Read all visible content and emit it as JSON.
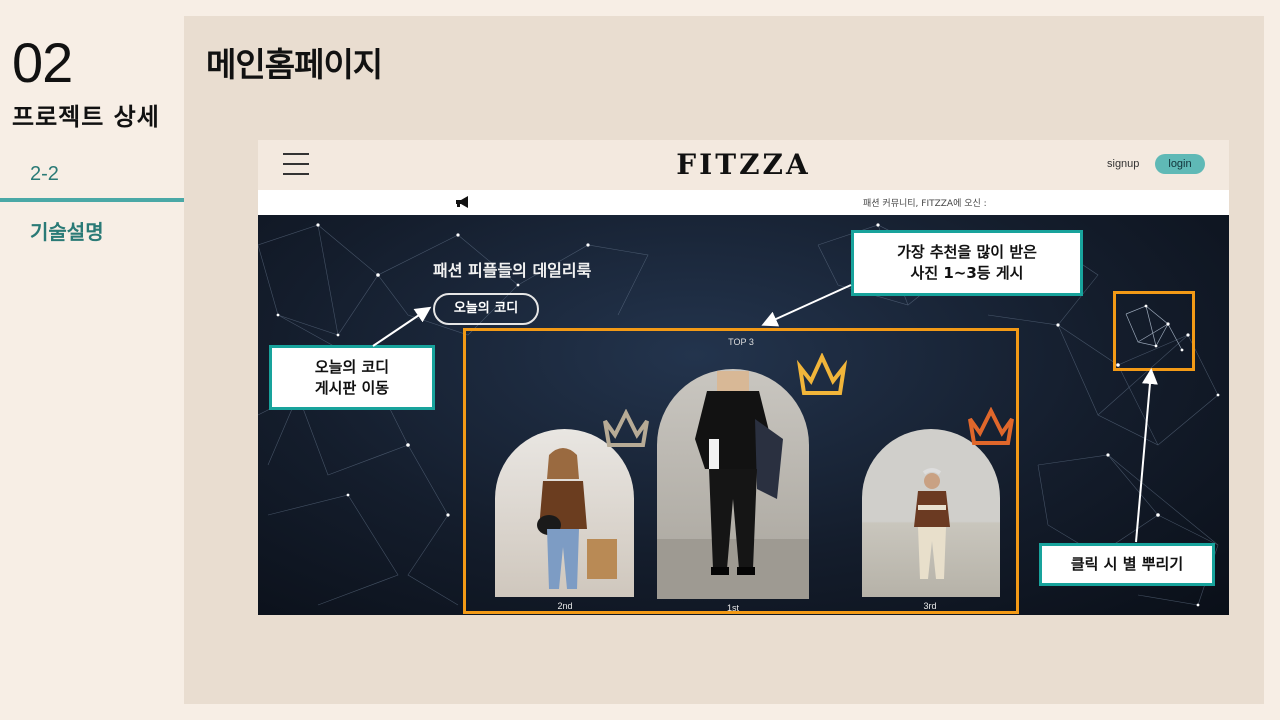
{
  "sidebar": {
    "section_number": "02",
    "section_title": "프로젝트 상세",
    "sub_number": "2-2",
    "sub_title": "기술설명"
  },
  "page": {
    "heading": "메인홈페이지"
  },
  "site": {
    "brand": "FITZZA",
    "signup_label": "signup",
    "login_label": "login",
    "notice_text": "패션 커뮤니티, FITZZA에 오신 :",
    "hero_title": "패션 피플들의 데일리룩",
    "today_button": "오늘의 코디",
    "top3_label": "TOP 3",
    "places": [
      "2nd",
      "1st",
      "3rd"
    ]
  },
  "callouts": {
    "today_board": "오늘의 코디\n게시판 이동",
    "top_recommended": "가장 추천을 많이 받은\n사진 1~3등 게시",
    "click_stars": "클릭 시 별 뿌리기"
  },
  "colors": {
    "accent_teal": "#18a39c",
    "highlight_orange": "#f39a16",
    "panel_bg": "#e9ddd0",
    "page_bg": "#f7eee5"
  }
}
